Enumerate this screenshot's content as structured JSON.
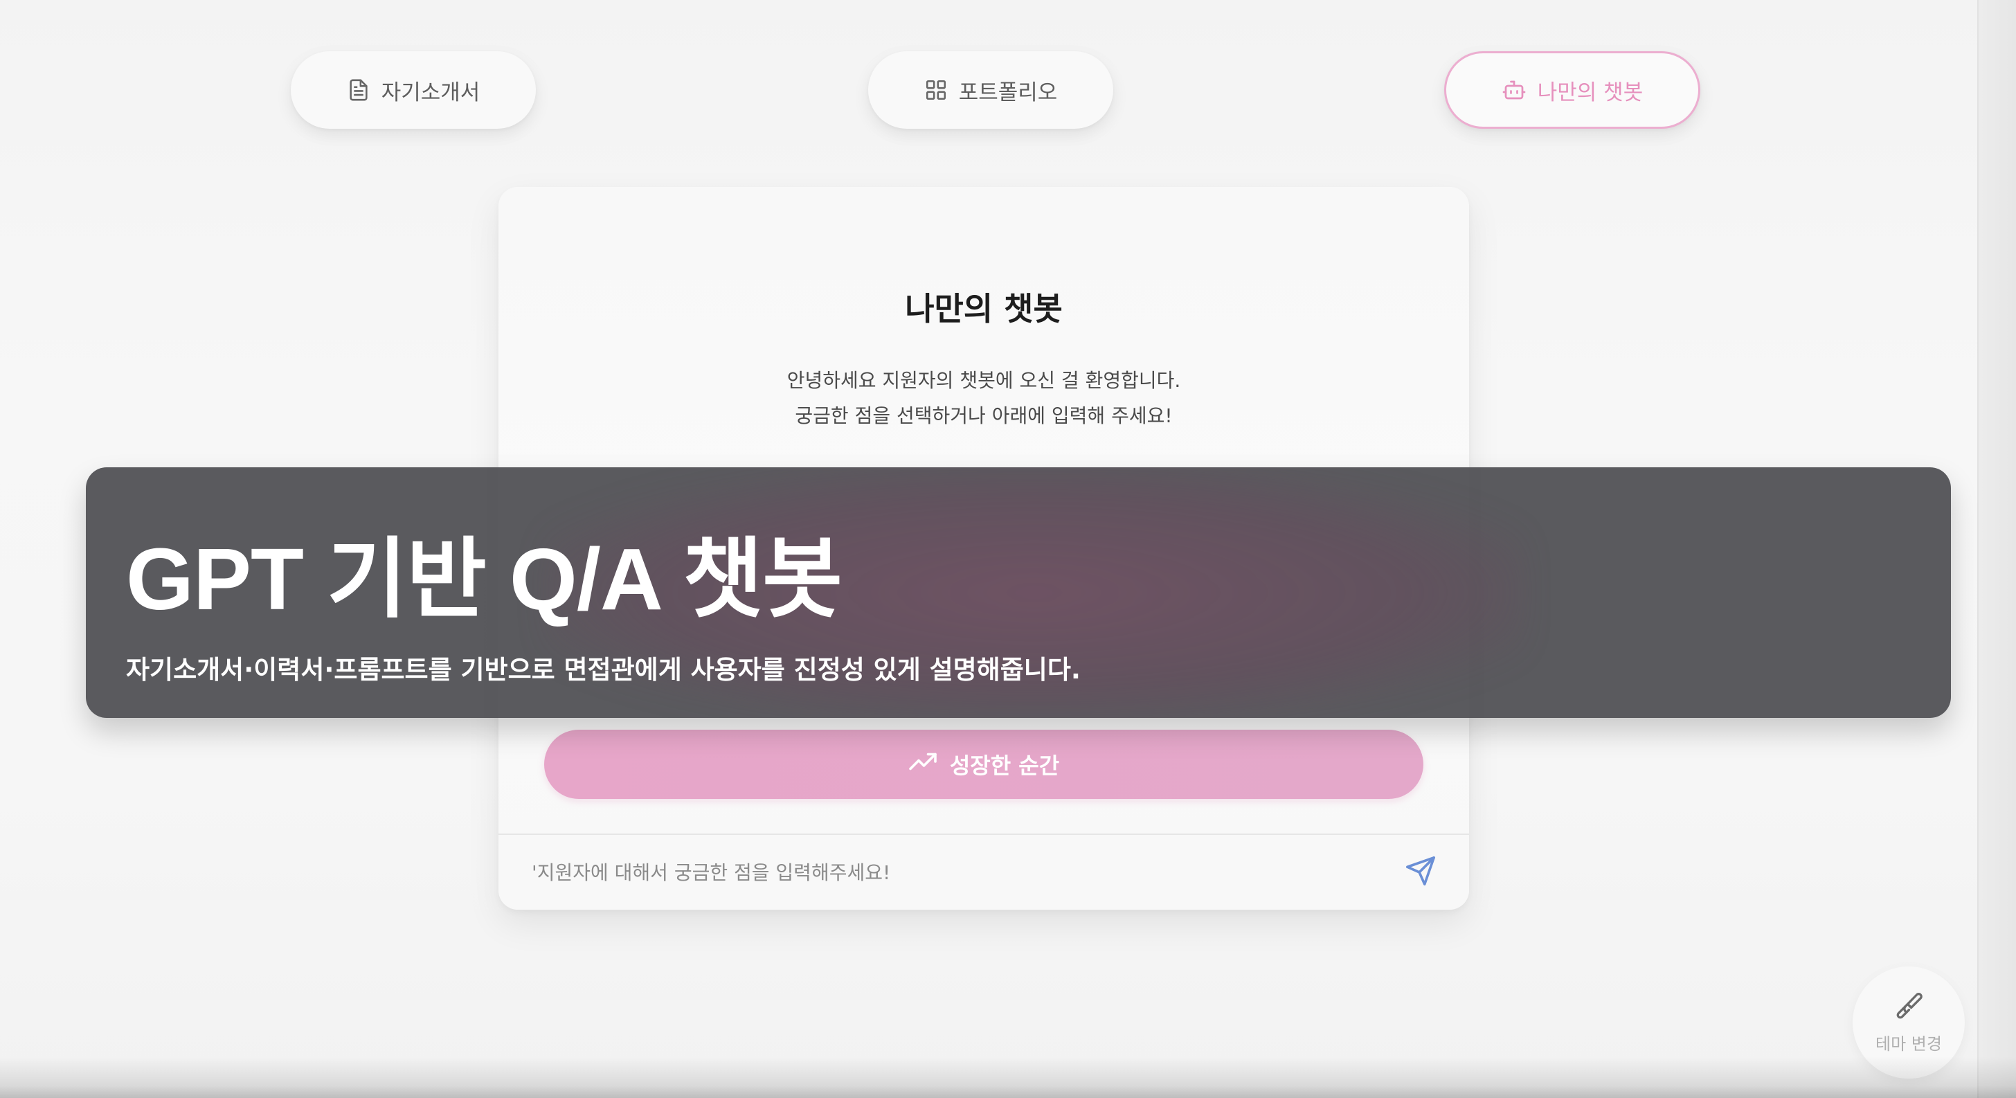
{
  "nav": {
    "items": [
      {
        "label": "자기소개서",
        "icon": "document-icon"
      },
      {
        "label": "포트폴리오",
        "icon": "grid-icon"
      },
      {
        "label": "나만의 챗봇",
        "icon": "bot-icon",
        "active": true
      }
    ]
  },
  "chatbot": {
    "title": "나만의 챗봇",
    "intro_line1": "안녕하세요 지원자의 챗봇에 오신 걸 환영합니다.",
    "intro_line2": "궁금한 점을 선택하거나 아래에 입력해 주세요!",
    "topic_button": {
      "label": "성장한 순간",
      "icon": "trending-up-icon"
    },
    "input": {
      "placeholder": "'지원자에 대해서 궁금한 점을 입력해주세요!",
      "value": ""
    },
    "send_icon": "send-icon"
  },
  "overlay": {
    "title": "GPT 기반 Q/A 챗봇",
    "subtitle": "자기소개서·이력서·프롬프트를 기반으로 면접관에게 사용자를 진정성 있게 설명해줍니다."
  },
  "theme_button": {
    "label": "테마 변경",
    "icon": "paintbrush-icon"
  },
  "colors": {
    "accent_pink": "#e4a8ca",
    "active_nav_pink": "#e690bd",
    "send_blue": "#6a8fd6",
    "overlay_dark": "#4e4e52"
  }
}
